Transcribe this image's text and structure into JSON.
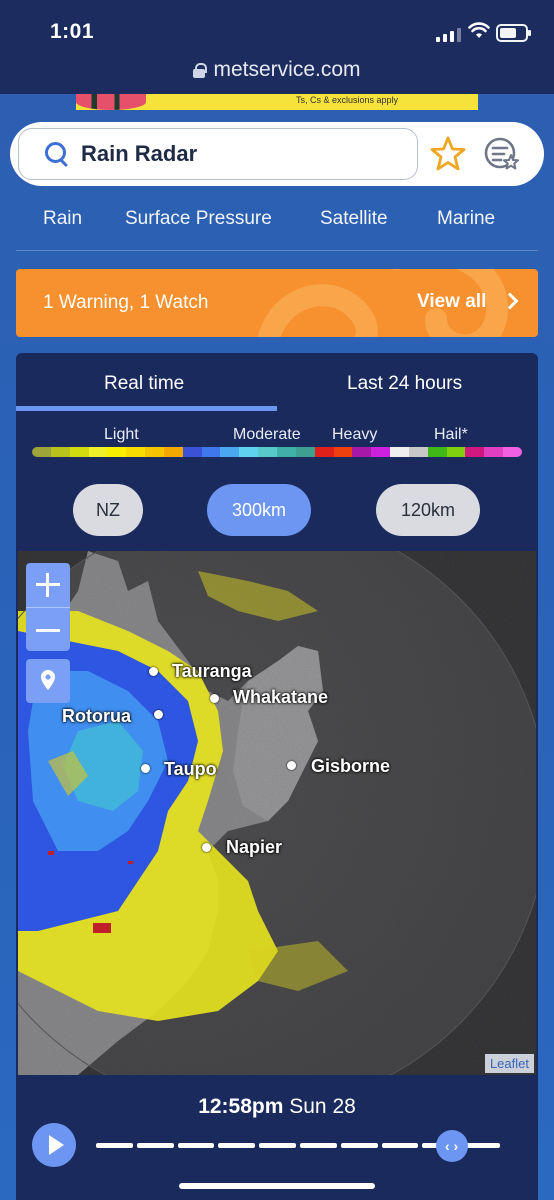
{
  "status": {
    "time": "1:01"
  },
  "browser": {
    "url": "metservice.com"
  },
  "ad": {
    "text": "Ts, Cs & exclusions apply"
  },
  "search": {
    "value": "Rain Radar"
  },
  "nav": {
    "items": [
      "Rain",
      "Surface Pressure",
      "Satellite",
      "Marine"
    ]
  },
  "warning": {
    "text": "1 Warning, 1 Watch",
    "link": "View all"
  },
  "tabs": {
    "realtime": "Real time",
    "last24": "Last 24 hours"
  },
  "legend": {
    "labels": [
      "Light",
      "Moderate",
      "Heavy",
      "Hail*"
    ],
    "colors": [
      "#9ea33a",
      "#b7c21d",
      "#d2db0e",
      "#f0f02a",
      "#f7f000",
      "#f6dc00",
      "#f4c400",
      "#f2a800",
      "#3a52d8",
      "#3f78ee",
      "#49a8f0",
      "#5fd2f0",
      "#58c8c8",
      "#40b0a8",
      "#3da090",
      "#e0201a",
      "#f04010",
      "#a818a8",
      "#cc22dd",
      "#f0f0f0",
      "#c8c8c8",
      "#40b818",
      "#80d010",
      "#d01880",
      "#e040c0",
      "#f060e0"
    ]
  },
  "zoom": {
    "options": [
      "NZ",
      "300km",
      "120km"
    ],
    "selected": "300km"
  },
  "map": {
    "cities": [
      "Tauranga",
      "Whakatane",
      "Rotorua",
      "Taupo",
      "Gisborne",
      "Napier"
    ],
    "attribution": "Leaflet"
  },
  "timeline": {
    "time": "12:58pm",
    "day": "Sun 28",
    "progress": 0.88
  },
  "colors": {
    "accent": "#6d96f2",
    "warning": "#f7902f",
    "panel": "#1a2a5c"
  }
}
